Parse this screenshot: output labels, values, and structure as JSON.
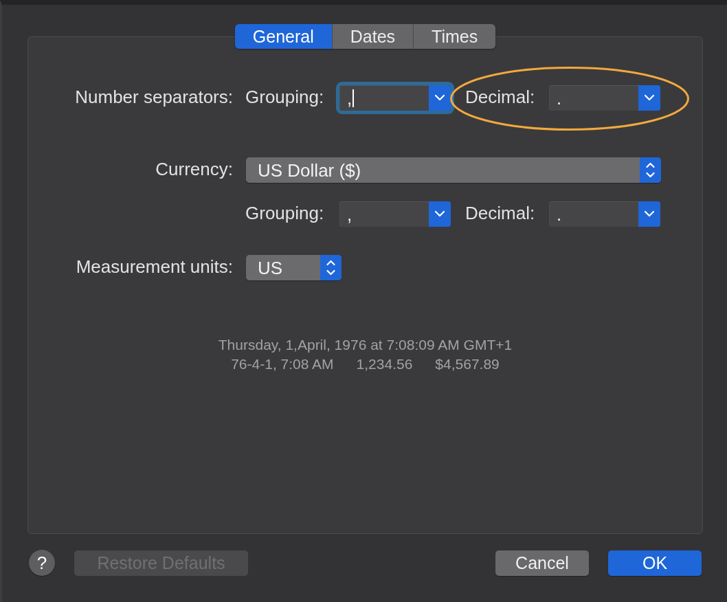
{
  "tabs": [
    {
      "label": "General",
      "selected": true
    },
    {
      "label": "Dates",
      "selected": false
    },
    {
      "label": "Times",
      "selected": false
    }
  ],
  "number_separators": {
    "label": "Number separators:",
    "grouping": {
      "label": "Grouping:",
      "value": ",",
      "focused": true,
      "highlighted": false
    },
    "decimal": {
      "label": "Decimal:",
      "value": ".",
      "focused": false,
      "highlighted": true
    }
  },
  "currency": {
    "label": "Currency:",
    "value": "US Dollar ($)",
    "grouping": {
      "label": "Grouping:",
      "value": ",",
      "focused": false,
      "highlighted": false
    },
    "decimal": {
      "label": "Decimal:",
      "value": ".",
      "focused": false,
      "highlighted": false
    }
  },
  "measurement_units": {
    "label": "Measurement units:",
    "value": "US"
  },
  "sample": {
    "line_1": "Thursday, 1,April, 1976 at 7:08:09 AM GMT+1",
    "line_2": [
      "76-4-1, 7:08 AM",
      "1,234.56",
      "$4,567.89"
    ]
  },
  "footer": {
    "help": {
      "label": "?"
    },
    "left_buttons": [
      {
        "label": "Restore Defaults",
        "disabled": true,
        "default": false
      }
    ],
    "right_buttons": [
      {
        "label": "Cancel",
        "disabled": false,
        "default": false
      },
      {
        "label": "OK",
        "disabled": false,
        "default": true
      }
    ]
  }
}
